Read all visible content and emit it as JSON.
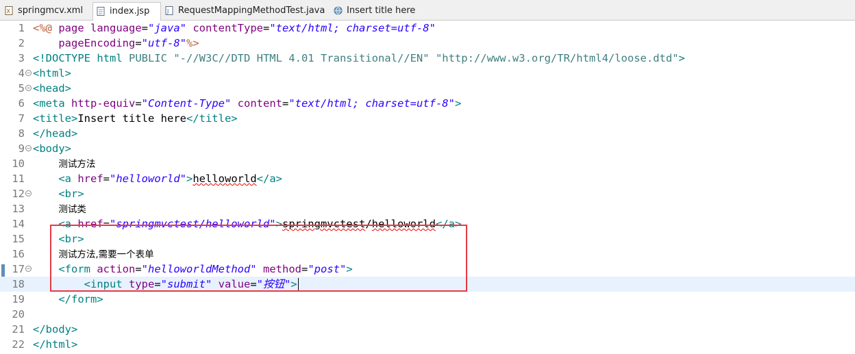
{
  "tabs": [
    {
      "label": "springmcv.xml",
      "icon": "xml-file-icon",
      "active": false
    },
    {
      "label": "index.jsp",
      "icon": "jsp-file-icon",
      "active": true
    },
    {
      "label": "RequestMappingMethodTest.java",
      "icon": "java-file-icon",
      "active": false
    },
    {
      "label": "Insert title here",
      "icon": "globe-icon",
      "active": false
    }
  ],
  "colors": {
    "tag": "#008080",
    "attribute": "#7f007f",
    "string": "#2a00ff",
    "directive": "#bf5f3f",
    "highlight": "#e63946"
  },
  "editor": {
    "current_line": 18,
    "lines": [
      {
        "n": "1",
        "fold": false,
        "tokens": [
          [
            "dir",
            "<%@ "
          ],
          [
            "at",
            "page "
          ],
          [
            "at",
            "language"
          ],
          [
            "tx",
            "="
          ],
          [
            "st",
            "\"java\""
          ],
          [
            "tx",
            " "
          ],
          [
            "at",
            "contentType"
          ],
          [
            "tx",
            "="
          ],
          [
            "st",
            "\"text/html; charset=utf-8\""
          ]
        ]
      },
      {
        "n": "2",
        "fold": false,
        "tokens": [
          [
            "tx",
            "    "
          ],
          [
            "at",
            "pageEncoding"
          ],
          [
            "tx",
            "="
          ],
          [
            "st",
            "\"utf-8\""
          ],
          [
            "dir",
            "%>"
          ]
        ]
      },
      {
        "n": "3",
        "fold": false,
        "tokens": [
          [
            "tg",
            "<!DOCTYPE "
          ],
          [
            "tg",
            "html "
          ],
          [
            "dt",
            "PUBLIC "
          ],
          [
            "dt",
            "\"-//W3C//DTD HTML 4.01 Transitional//EN\" "
          ],
          [
            "dt",
            "\"http://www.w3.org/TR/html4/loose.dtd\""
          ],
          [
            "tg",
            ">"
          ]
        ]
      },
      {
        "n": "4",
        "fold": true,
        "tokens": [
          [
            "tg",
            "<html>"
          ]
        ]
      },
      {
        "n": "5",
        "fold": true,
        "tokens": [
          [
            "tg",
            "<head>"
          ]
        ]
      },
      {
        "n": "6",
        "fold": false,
        "tokens": [
          [
            "tg",
            "<meta "
          ],
          [
            "at",
            "http-equiv"
          ],
          [
            "tx",
            "="
          ],
          [
            "st",
            "\"Content-Type\""
          ],
          [
            "tx",
            " "
          ],
          [
            "at",
            "content"
          ],
          [
            "tx",
            "="
          ],
          [
            "st",
            "\"text/html; charset=utf-8\""
          ],
          [
            "tg",
            ">"
          ]
        ]
      },
      {
        "n": "7",
        "fold": false,
        "tokens": [
          [
            "tg",
            "<title>"
          ],
          [
            "tx",
            "Insert title here"
          ],
          [
            "tg",
            "</title>"
          ]
        ]
      },
      {
        "n": "8",
        "fold": false,
        "tokens": [
          [
            "tg",
            "</head>"
          ]
        ]
      },
      {
        "n": "9",
        "fold": true,
        "tokens": [
          [
            "tg",
            "<body>"
          ]
        ]
      },
      {
        "n": "10",
        "fold": false,
        "tokens": [
          [
            "tx",
            "    "
          ],
          [
            "zh",
            "测试方法"
          ]
        ]
      },
      {
        "n": "11",
        "fold": false,
        "tokens": [
          [
            "tx",
            "    "
          ],
          [
            "tg",
            "<a "
          ],
          [
            "at",
            "href"
          ],
          [
            "tx",
            "="
          ],
          [
            "st",
            "\"helloworld\""
          ],
          [
            "tg",
            ">"
          ],
          [
            "sq",
            "helloworld"
          ],
          [
            "tg",
            "</a>"
          ]
        ]
      },
      {
        "n": "12",
        "fold": true,
        "tokens": [
          [
            "tx",
            "    "
          ],
          [
            "tg",
            "<br>"
          ]
        ]
      },
      {
        "n": "13",
        "fold": false,
        "tokens": [
          [
            "tx",
            "    "
          ],
          [
            "zh",
            "测试类"
          ]
        ]
      },
      {
        "n": "14",
        "fold": false,
        "tokens": [
          [
            "tx",
            "    "
          ],
          [
            "tg",
            "<a "
          ],
          [
            "at",
            "href"
          ],
          [
            "tx",
            "="
          ],
          [
            "st",
            "\"springmvctest/helloworld\""
          ],
          [
            "tg",
            ">"
          ],
          [
            "sq",
            "springmvctest"
          ],
          [
            "tx",
            "/"
          ],
          [
            "sq",
            "helloworld"
          ],
          [
            "tg",
            "</a>"
          ]
        ]
      },
      {
        "n": "15",
        "fold": false,
        "tokens": [
          [
            "tx",
            "    "
          ],
          [
            "tg",
            "<br>"
          ]
        ]
      },
      {
        "n": "16",
        "fold": false,
        "tokens": [
          [
            "tx",
            "    "
          ],
          [
            "zh",
            "测试方法,需要一个表单"
          ]
        ]
      },
      {
        "n": "17",
        "fold": true,
        "tokens": [
          [
            "tx",
            "    "
          ],
          [
            "tg",
            "<form "
          ],
          [
            "at",
            "action"
          ],
          [
            "tx",
            "="
          ],
          [
            "st",
            "\"helloworldMethod\""
          ],
          [
            "tx",
            " "
          ],
          [
            "at",
            "method"
          ],
          [
            "tx",
            "="
          ],
          [
            "st",
            "\"post\""
          ],
          [
            "tg",
            ">"
          ]
        ]
      },
      {
        "n": "18",
        "fold": false,
        "tokens": [
          [
            "tx",
            "        "
          ],
          [
            "tg",
            "<input "
          ],
          [
            "at",
            "type"
          ],
          [
            "tx",
            "="
          ],
          [
            "st",
            "\"submit\""
          ],
          [
            "tx",
            " "
          ],
          [
            "at",
            "value"
          ],
          [
            "tx",
            "="
          ],
          [
            "st",
            "\"按钮\""
          ],
          [
            "tg",
            ">"
          ]
        ]
      },
      {
        "n": "19",
        "fold": false,
        "tokens": [
          [
            "tx",
            "    "
          ],
          [
            "tg",
            "</form>"
          ]
        ]
      },
      {
        "n": "20",
        "fold": false,
        "tokens": []
      },
      {
        "n": "21",
        "fold": false,
        "tokens": [
          [
            "tg",
            "</body>"
          ]
        ]
      },
      {
        "n": "22",
        "fold": false,
        "tokens": [
          [
            "tg",
            "</html>"
          ]
        ]
      }
    ]
  }
}
